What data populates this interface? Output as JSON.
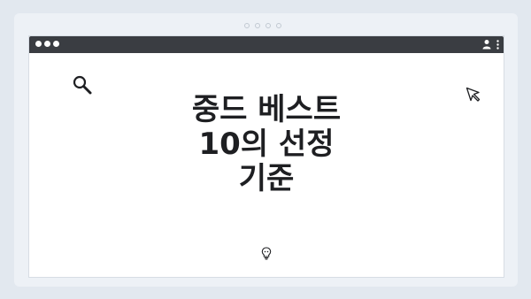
{
  "illustration": {
    "headline_lines": [
      "중드 베스트",
      "10의 선정",
      "기준"
    ],
    "icons": [
      "search-icon",
      "cursor-arrow-icon",
      "lightbulb-icon",
      "user-icon",
      "kebab-menu-icon"
    ]
  },
  "colors": {
    "background": "#e2e8ef",
    "titlebar": "#3a3d42",
    "text": "#1e1f22"
  }
}
